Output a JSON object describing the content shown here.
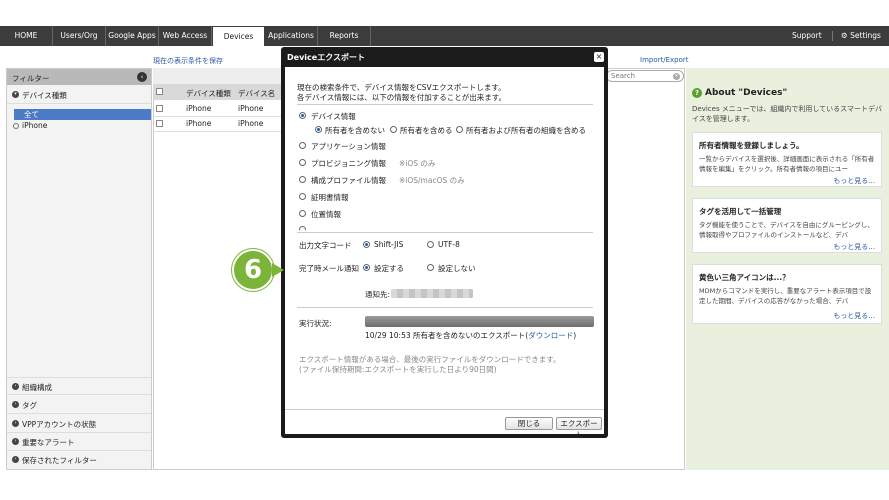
{
  "nav": {
    "items": [
      "HOME",
      "Users/Org",
      "Google Apps",
      "Web Access",
      "Devices",
      "Applications",
      "Reports"
    ],
    "support": "Support",
    "settings": "Settings"
  },
  "sub": {
    "save_filter": "現在の表示条件を保存",
    "import_export": "Import/Export"
  },
  "filter": {
    "title": "フィルター",
    "device_type": "デバイス種類",
    "all": "全て",
    "iphone": "iPhone",
    "sections": [
      "組織構成",
      "タグ",
      "VPPアカウントの状態",
      "重要なアラート",
      "保存されたフィルター"
    ]
  },
  "table": {
    "headers": [
      "デバイス種類",
      "デバイス名"
    ],
    "rows": [
      [
        "iPhone",
        "iPhone"
      ],
      [
        "iPhone",
        "iPhone"
      ]
    ],
    "search_placeholder": "Search"
  },
  "about": {
    "title": "About \"Devices\"",
    "text": "Devices メニューでは、組織内で利用しているスマートデバイスを管理します。",
    "cards": [
      {
        "title": "所有者情報を登録しましょう。",
        "body": "一覧からデバイスを選択後、詳細画面に表示される「所有者情報を編集」をクリック。所有者情報の項目にユー",
        "more": "もっと見る..."
      },
      {
        "title": "タグを活用して一括管理",
        "body": "タグ機能を使うことで、デバイスを自由にグルーピングし、情報取得やプロファイルのインストールなど、デバ",
        "more": "もっと見る..."
      },
      {
        "title": "黄色い三角アイコンは...？",
        "body": "MDMからコマンドを実行し、重要なアラート表示項目で設定した期間、デバイスの応答がなかった場合、デバ",
        "more": "もっと見る..."
      }
    ]
  },
  "modal": {
    "title": "Deviceエクスポート",
    "intro1": "現在の検索条件で、デバイス情報をCSVエクスポートします。",
    "intro2": "各デバイス情報には、以下の情報を付加することが出来ます。",
    "opt_device": "デバイス情報",
    "sub_opts": [
      "所有者を含めない",
      "所有者を含める",
      "所有者および所有者の組織を含める"
    ],
    "opt_app": "アプリケーション情報",
    "opt_prov": "プロビジョニング情報",
    "opt_prov_note": "※iOS のみ",
    "opt_profile": "構成プロファイル情報",
    "opt_profile_note": "※iOS/macOS のみ",
    "opt_cert": "証明書情報",
    "opt_location": "位置情報",
    "encoding_label": "出力文字コード",
    "encoding_opts": [
      "Shift-JIS",
      "UTF-8"
    ],
    "notify_label": "完了時メール通知",
    "notify_opts": [
      "設定する",
      "設定しない"
    ],
    "notify_to": "通知先:",
    "status_label": "実行状況:",
    "status_text": "10/29 10:53 所有者を含めないのエクスポート(",
    "status_link": "ダウンロード",
    "status_close": ")",
    "note1": "エクスポート情報がある場合、最後の実行ファイルをダウンロードできます。",
    "note2": "(ファイル保持期間:エクスポートを実行した日より90日間)",
    "close_btn": "閉じる",
    "export_btn": "エクスポート"
  },
  "step": "6"
}
